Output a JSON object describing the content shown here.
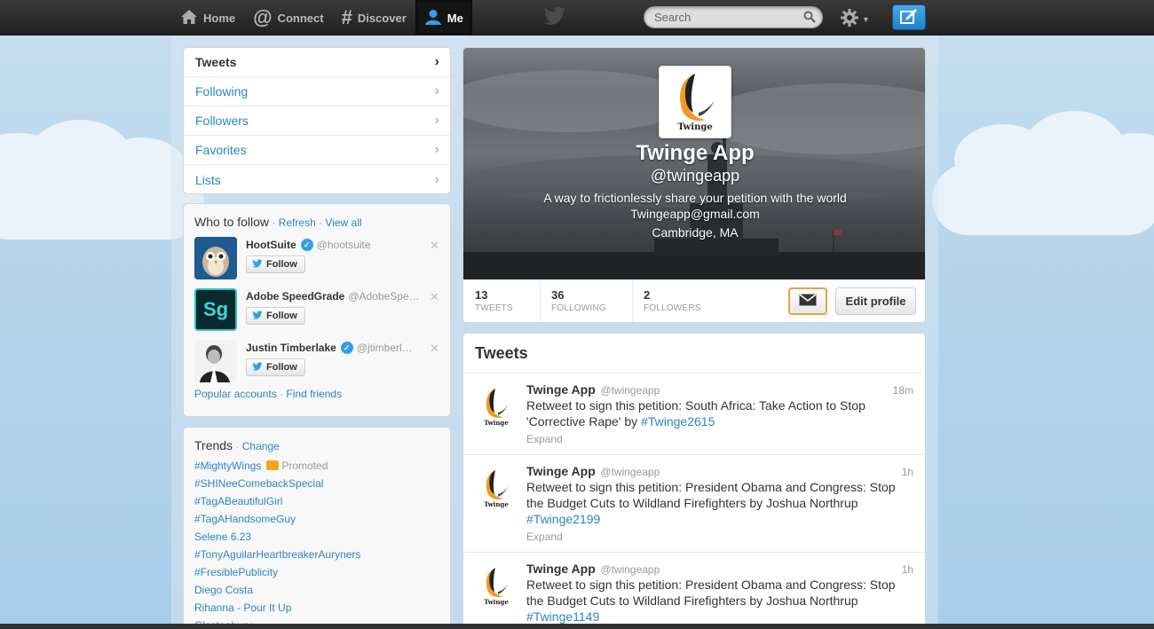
{
  "colors": {
    "link": "#2a86c0",
    "accent": "#2fa0ec",
    "topbar": "#2a2a2a",
    "dm_border": "#e8a440"
  },
  "nav": {
    "items": [
      {
        "label": "Home",
        "icon": "home-icon"
      },
      {
        "label": "Connect",
        "icon": "at-icon"
      },
      {
        "label": "Discover",
        "icon": "hash-icon"
      },
      {
        "label": "Me",
        "icon": "person-icon"
      }
    ],
    "search_placeholder": "Search"
  },
  "dashboard": {
    "items": [
      {
        "label": "Tweets"
      },
      {
        "label": "Following"
      },
      {
        "label": "Followers"
      },
      {
        "label": "Favorites"
      },
      {
        "label": "Lists"
      }
    ]
  },
  "who_to_follow": {
    "title": "Who to follow",
    "sep1": " · ",
    "refresh": "Refresh",
    "sep2": " · ",
    "view_all": "View all",
    "follow_label": "Follow",
    "suggestions": [
      {
        "name": "HootSuite",
        "handle": "@hootsuite",
        "verified": true
      },
      {
        "name": "Adobe SpeedGrade",
        "handle": "@AdobeSpe…",
        "verified": false,
        "avatar_text": "Sg"
      },
      {
        "name": "Justin Timberlake",
        "handle": "@jtimberl…",
        "verified": true
      }
    ],
    "popular": "Popular accounts",
    "sep3": " · ",
    "find_friends": "Find friends"
  },
  "trends": {
    "title": "Trends",
    "sep": " · ",
    "change": "Change",
    "promoted_label": "Promoted",
    "items": [
      "#MightyWings",
      "#SHINeeComebackSpecial",
      "#TagABeautifulGirl",
      "#TagAHandsomeGuy",
      "Selene 6.23",
      "#TonyAguilarHeartbreakerAuryners",
      "#FresiblePublicity",
      "Diego Costa",
      "Rihanna - Pour It Up",
      "Glastonbury"
    ]
  },
  "profile": {
    "avatar_text": "Twinge",
    "name": "Twinge App",
    "handle": "@twingeapp",
    "bio": "A way to frictionlessly share your petition with the world",
    "email": "Twingeapp@gmail.com",
    "location": "Cambridge, MA",
    "stats": [
      {
        "num": "13",
        "label": "TWEETS"
      },
      {
        "num": "36",
        "label": "FOLLOWING"
      },
      {
        "num": "2",
        "label": "FOLLOWERS"
      }
    ],
    "edit_label": "Edit profile"
  },
  "stream": {
    "title": "Tweets",
    "expand_label": "Expand",
    "tweets": [
      {
        "name": "Twinge App",
        "handle": "@twingeapp",
        "time": "18m",
        "text": "Retweet to sign this petition: South Africa: Take Action to Stop 'Corrective Rape' by ",
        "tag": "#Twinge2615"
      },
      {
        "name": "Twinge App",
        "handle": "@twingeapp",
        "time": "1h",
        "text": "Retweet to sign this petition: President Obama and Congress: Stop the Budget Cuts to Wildland Firefighters by Joshua Northrup ",
        "tag": "#Twinge2199"
      },
      {
        "name": "Twinge App",
        "handle": "@twingeapp",
        "time": "1h",
        "text": "Retweet to sign this petition: President Obama and Congress: Stop the Budget Cuts to Wildland Firefighters by Joshua Northrup ",
        "tag": "#Twinge1149"
      }
    ]
  }
}
